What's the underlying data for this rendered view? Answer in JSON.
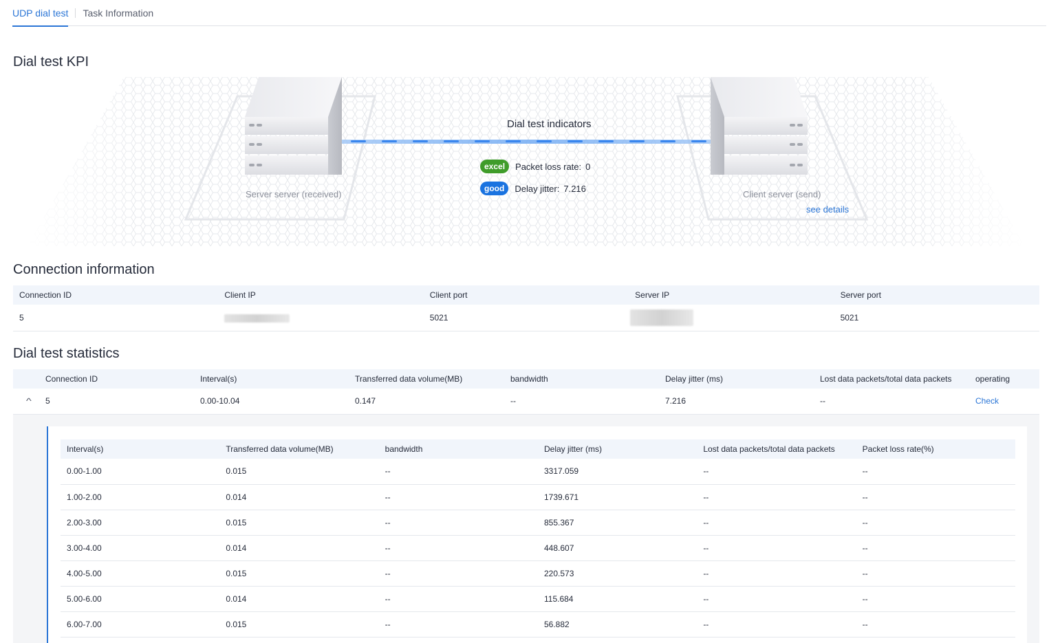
{
  "tabs": [
    {
      "label": "UDP dial test"
    },
    {
      "label": "Task Information"
    }
  ],
  "kpi": {
    "title": "Dial test KPI",
    "server_label": "Server server (received)",
    "client_label": "Client server (send)",
    "indicators_title": "Dial test indicators",
    "packet_loss": {
      "badge": "excel",
      "label": "Packet loss rate:",
      "value": "0"
    },
    "delay_jitter": {
      "badge": "good",
      "label": "Delay jitter:",
      "value": "7.216"
    },
    "details_link": "see details"
  },
  "connection": {
    "title": "Connection information",
    "headers": [
      "Connection ID",
      "Client IP",
      "Client port",
      "Server IP",
      "Server port"
    ],
    "row": {
      "id": "5",
      "client_port": "5021",
      "server_port": "5021"
    }
  },
  "statistics": {
    "title": "Dial test statistics",
    "headers": [
      "Connection ID",
      "Interval(s)",
      "Transferred data volume(MB)",
      "bandwidth",
      "Delay jitter (ms)",
      "Lost data packets/total data packets",
      "operating"
    ],
    "row": {
      "id": "5",
      "interval": "0.00-10.04",
      "volume": "0.147",
      "bandwidth": "--",
      "jitter": "7.216",
      "lost": "--",
      "action": "Check"
    },
    "detail_headers": [
      "Interval(s)",
      "Transferred data volume(MB)",
      "bandwidth",
      "Delay jitter (ms)",
      "Lost data packets/total data packets",
      "Packet loss rate(%)"
    ],
    "detail_rows": [
      [
        "0.00-1.00",
        "0.015",
        "--",
        "3317.059",
        "--",
        "--"
      ],
      [
        "1.00-2.00",
        "0.014",
        "--",
        "1739.671",
        "--",
        "--"
      ],
      [
        "2.00-3.00",
        "0.015",
        "--",
        "855.367",
        "--",
        "--"
      ],
      [
        "3.00-4.00",
        "0.014",
        "--",
        "448.607",
        "--",
        "--"
      ],
      [
        "4.00-5.00",
        "0.015",
        "--",
        "220.573",
        "--",
        "--"
      ],
      [
        "5.00-6.00",
        "0.014",
        "--",
        "115.684",
        "--",
        "--"
      ],
      [
        "6.00-7.00",
        "0.015",
        "--",
        "56.882",
        "--",
        "--"
      ]
    ]
  }
}
